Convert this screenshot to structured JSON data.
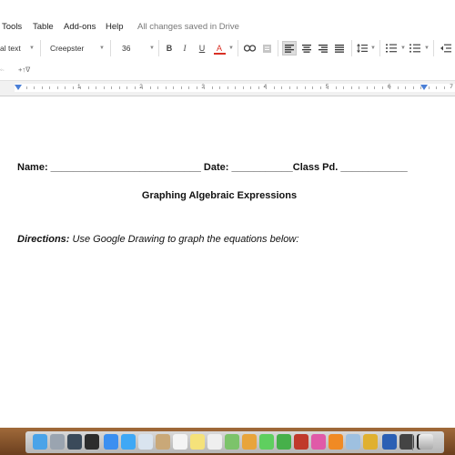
{
  "menu": {
    "items": [
      "Tools",
      "Table",
      "Add-ons",
      "Help"
    ],
    "status": "All changes saved in Drive"
  },
  "toolbar": {
    "style_value": "al text",
    "font_value": "Creepster",
    "size_value": "36",
    "bold": "B",
    "italic": "I",
    "underline": "U",
    "text_color": "A"
  },
  "toolbar2": {
    "left": "+↑∇"
  },
  "ruler": {
    "numbers": [
      "1",
      "2",
      "3",
      "4",
      "5",
      "6",
      "7"
    ]
  },
  "document": {
    "line1": "Name: ___________________________ Date: ___________Class Pd. ____________",
    "title": "Graphing Algebraic Expressions",
    "directions_label": "Directions:",
    "directions_text": " Use Google Drawing to graph the equations below:"
  },
  "colors": {
    "accent_underline": "#d93025",
    "ruler_marker": "#4a7fd6"
  }
}
